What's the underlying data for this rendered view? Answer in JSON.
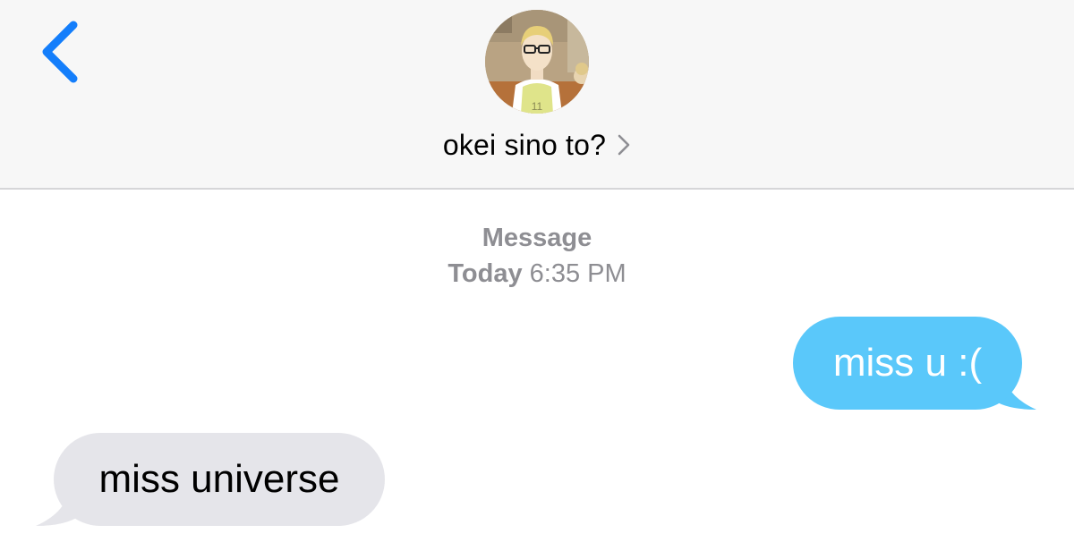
{
  "header": {
    "contact_name": "okei sino to?",
    "back_icon": "chevron-left-icon",
    "detail_icon": "chevron-right-icon",
    "accent_color": "#147efb"
  },
  "thread": {
    "label": "Message",
    "day": "Today",
    "time": "6:35 PM"
  },
  "messages": [
    {
      "direction": "outgoing",
      "text": "miss u :(",
      "color": "#5ac8fa"
    },
    {
      "direction": "incoming",
      "text": "miss universe",
      "color": "#e5e5ea"
    }
  ]
}
